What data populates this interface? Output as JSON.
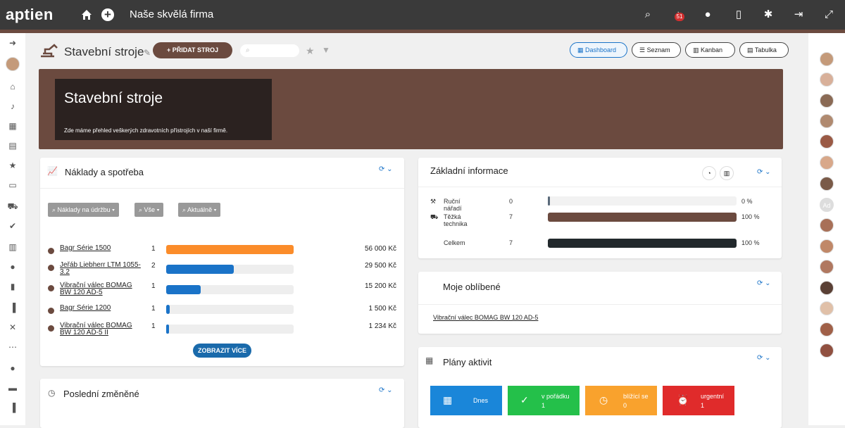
{
  "brand": "aptien",
  "company": "Naše skvělá firma",
  "notifications": "51",
  "page_title": "Stavební stroje",
  "add_button": "+ PŘIDAT STROJ",
  "views": [
    {
      "label": "Dashboard",
      "active": true
    },
    {
      "label": "Seznam"
    },
    {
      "label": "Kanban"
    },
    {
      "label": "Tabulka"
    }
  ],
  "hero": {
    "title": "Stavební stroje",
    "description": "Zde máme přehled veškerých zdravotních přístrojích v naší firmě."
  },
  "costs": {
    "title": "Náklady a spotřeba",
    "filters": [
      "Náklady na údržbu",
      "Vše",
      "Aktuálně"
    ],
    "rows": [
      {
        "name": "Bagr Série 1500",
        "count": "1",
        "value": "56 000 Kč",
        "pct": 100,
        "color": "#fb8c2a"
      },
      {
        "name": "Jeřáb Liebherr LTM 1055-3.2",
        "count": "2",
        "value": "29 500 Kč",
        "pct": 53,
        "color": "#1a73c8"
      },
      {
        "name": "Vibrační válec BOMAG BW 120 AD-5",
        "count": "1",
        "value": "15 200 Kč",
        "pct": 27,
        "color": "#1a73c8"
      },
      {
        "name": "Bagr Série 1200",
        "count": "1",
        "value": "1 500 Kč",
        "pct": 3,
        "color": "#1a73c8"
      },
      {
        "name": "Vibrační válec BOMAG BW 120 AD-5 II",
        "count": "1",
        "value": "1 234 Kč",
        "pct": 2,
        "color": "#1a73c8"
      }
    ],
    "more": "ZOBRAZIT VÍCE"
  },
  "recent": {
    "title": "Poslední změněné"
  },
  "info": {
    "title": "Základní informace",
    "rows": [
      {
        "label": "Ruční nářadí",
        "count": "0",
        "pct_label": "0 %",
        "pct": 1,
        "color": "#5a6a7a"
      },
      {
        "label": "Těžká technika",
        "count": "7",
        "pct_label": "100 %",
        "pct": 100,
        "color": "#6b4a3f"
      },
      {
        "label": "Celkem",
        "count": "7",
        "pct_label": "100 %",
        "pct": 100,
        "color": "#22292c"
      }
    ]
  },
  "favorites": {
    "title": "Moje oblíbené",
    "items": [
      "Vibrační válec BOMAG BW 120 AD-5"
    ]
  },
  "plans": {
    "title": "Plány aktivit",
    "tiles": [
      {
        "label": "Dnes",
        "count": "",
        "color": "#1a86d9"
      },
      {
        "label": "v pořádku",
        "count": "1",
        "color": "#24c04a"
      },
      {
        "label": "blížící se",
        "count": "0",
        "color": "#f9a22d"
      },
      {
        "label": "urgentní",
        "count": "1",
        "color": "#e02b2b"
      }
    ]
  }
}
